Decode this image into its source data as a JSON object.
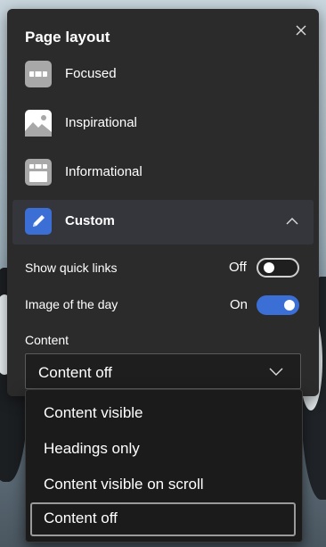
{
  "panel": {
    "title": "Page layout",
    "layouts": [
      {
        "label": "Focused",
        "icon": "focused-layout-icon"
      },
      {
        "label": "Inspirational",
        "icon": "landscape-image-icon"
      },
      {
        "label": "Informational",
        "icon": "informational-layout-icon"
      },
      {
        "label": "Custom",
        "icon": "pencil-icon",
        "selected": true,
        "expanded": true
      }
    ],
    "quick_links": {
      "label": "Show quick links",
      "state": "Off"
    },
    "image_of_day": {
      "label": "Image of the day",
      "state": "On"
    },
    "content": {
      "label": "Content",
      "selected": "Content off",
      "options": [
        "Content visible",
        "Headings only",
        "Content visible on scroll",
        "Content off"
      ]
    }
  },
  "colors": {
    "accent": "#3b6fd6",
    "panel": "#2b2b2b",
    "menu": "#1b1b1b"
  }
}
